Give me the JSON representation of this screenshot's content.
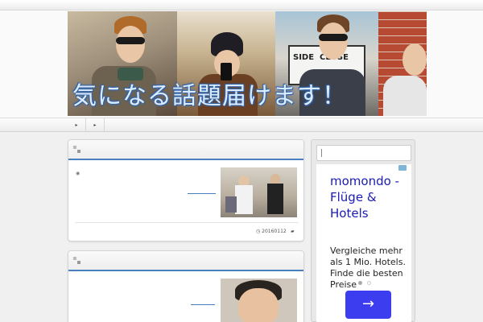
{
  "header": {
    "banner_title": "気になる話題届けます！",
    "sign_text_1": "SIDE",
    "sign_text_2": "CLOSE"
  },
  "nav": {
    "items": [
      "▸",
      "▸"
    ]
  },
  "posts": [
    {
      "meta_date": "20160112",
      "date_icon": "clock-icon",
      "category_icon": "folder-icon"
    },
    {}
  ],
  "sidebar": {
    "ad": {
      "title": "momondo - Flüge & Hotels",
      "body": "Vergleiche mehr als 1 Mio. Hotels. Finde die besten Preise",
      "button_symbol": "→",
      "accent": "#3d3df0",
      "title_color": "#1a1ab8"
    }
  },
  "colors": {
    "accent_line": "#4a7fbf",
    "page_bg": "#f0f0f0"
  }
}
